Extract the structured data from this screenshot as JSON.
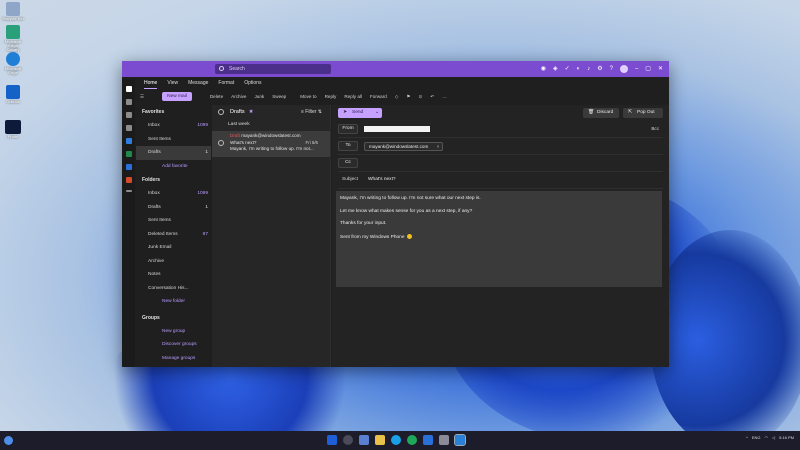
{
  "desktop": {
    "icons": [
      {
        "label": "Recycle Bin",
        "color": "#8fa6c9"
      },
      {
        "label": "Microsoft Edge Canary",
        "color": "#2aa07a"
      },
      {
        "label": "Microsoft Edge",
        "color": "#1f7fd6"
      },
      {
        "label": "Outlook",
        "color": "#1462c8"
      },
      {
        "label": "Photo",
        "color": "#0d1a3a"
      }
    ]
  },
  "window": {
    "search_placeholder": "Search",
    "tabs": [
      "Home",
      "View",
      "Message",
      "Format",
      "Options"
    ],
    "active_tab": "Home",
    "toolbar": {
      "new_mail": "New mail",
      "delete": "Delete",
      "archive": "Archive",
      "junk": "Junk",
      "sweep": "Sweep",
      "move_to": "Move to",
      "reply": "Reply",
      "reply_all": "Reply all",
      "forward": "Forward"
    }
  },
  "folders": {
    "favorites_header": "Favorites",
    "favorites": [
      {
        "label": "Inbox",
        "count": "1099"
      },
      {
        "label": "Sent Items",
        "count": ""
      },
      {
        "label": "Drafts",
        "count": "1"
      }
    ],
    "add_favorite": "Add favorite",
    "folders_header": "Folders",
    "folders": [
      {
        "label": "Inbox",
        "count": "1099"
      },
      {
        "label": "Drafts",
        "count": "1"
      },
      {
        "label": "Sent Items",
        "count": ""
      },
      {
        "label": "Deleted Items",
        "count": "87"
      },
      {
        "label": "Junk Email",
        "count": ""
      },
      {
        "label": "Archive",
        "count": ""
      },
      {
        "label": "Notes",
        "count": ""
      },
      {
        "label": "Conversation His...",
        "count": ""
      }
    ],
    "new_folder": "New folder",
    "groups_header": "Groups",
    "new_group": "New group",
    "discover_groups": "Discover groups",
    "manage_groups": "Manage groups"
  },
  "maillist": {
    "title": "Drafts",
    "filter": "Filter",
    "section": "Last week",
    "item": {
      "tag": "Draft",
      "from": "mayank@windowslatest.com",
      "subject": "What's next?",
      "date": "Fri 5/6",
      "preview": "Mayank, I'm writing to follow up. I'm not..."
    }
  },
  "compose": {
    "send": "Send",
    "discard": "Discard",
    "pop_out": "Pop Out",
    "from_label": "From",
    "bcc": "Bcc",
    "to_label": "To",
    "to_value": "mayank@windowslatest.com",
    "cc_label": "Cc",
    "subject_label": "Subject",
    "subject_value": "What's next?",
    "body": [
      "Mayank, I'm writing to follow up. I'm not sure what our next step is.",
      "Let me know what makes sense for you as a next step, if any?",
      "Thanks for your input.",
      "Sent from my Windows Phone"
    ]
  },
  "taskbar": {
    "apps": [
      "#1f5fd6",
      "#4a4a5a",
      "#5a7fd0",
      "#e9c14a",
      "#1aa0e6",
      "#1fa85a",
      "#2b6fd8",
      "#8a8a9a",
      "#2a7fd6"
    ],
    "tray": [
      "ENG",
      "IN",
      "5:16 PM"
    ]
  },
  "colors": {
    "accent": "#7b4cd0",
    "button": "#c6a1ff"
  }
}
